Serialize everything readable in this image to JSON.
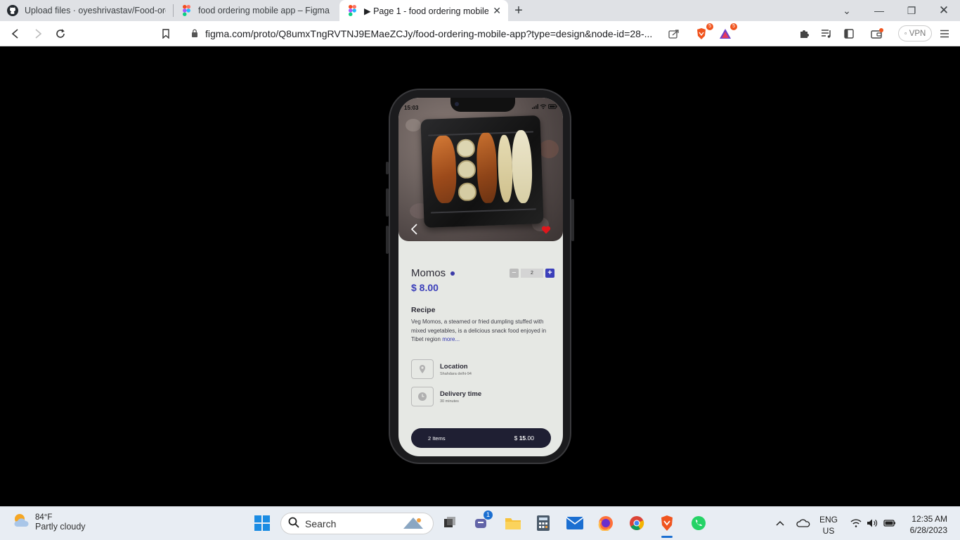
{
  "browser": {
    "tabs": [
      {
        "title": "Upload files · oyeshrivastav/Food-orde",
        "icon": "github-icon"
      },
      {
        "title": "food ordering mobile app – Figma",
        "icon": "figma-icon"
      },
      {
        "title": "▶ Page 1 - food ordering mobile",
        "icon": "figma-icon",
        "active": true
      }
    ],
    "url": "figma.com/proto/Q8umxTngRVTNJ9EMaeZCJy/food-ordering-mobile-app?type=design&node-id=28-...",
    "brave_shield_count": "5",
    "rewards_count": "5",
    "vpn_label": "VPN"
  },
  "app": {
    "status_time": "15:03",
    "product": {
      "name": "Momos",
      "price": "$ 8.00",
      "quantity": "2"
    },
    "recipe": {
      "heading": "Recipe",
      "text": "Veg Momos, a steamed or fried dumpling stuffed with mixed vegetables, is a delicious snack food enjoyed in Tibet region",
      "more_label": "more..."
    },
    "location": {
      "label": "Location",
      "value": "Shahdara delhi-94"
    },
    "delivery": {
      "label": "Delivery time",
      "value": "30 minutes"
    },
    "cart": {
      "items_label": "2 Items",
      "currency": "$",
      "total_int": "15",
      "total_dec": ".00"
    },
    "colors": {
      "accent": "#3b3fba",
      "dark": "#1f1f33",
      "heart": "#e0161c"
    }
  },
  "taskbar": {
    "weather_temp": "84°F",
    "weather_desc": "Partly cloudy",
    "search_placeholder": "Search",
    "chat_badge": "1",
    "lang_1": "ENG",
    "lang_2": "US",
    "time": "12:35 AM",
    "date": "6/28/2023"
  }
}
